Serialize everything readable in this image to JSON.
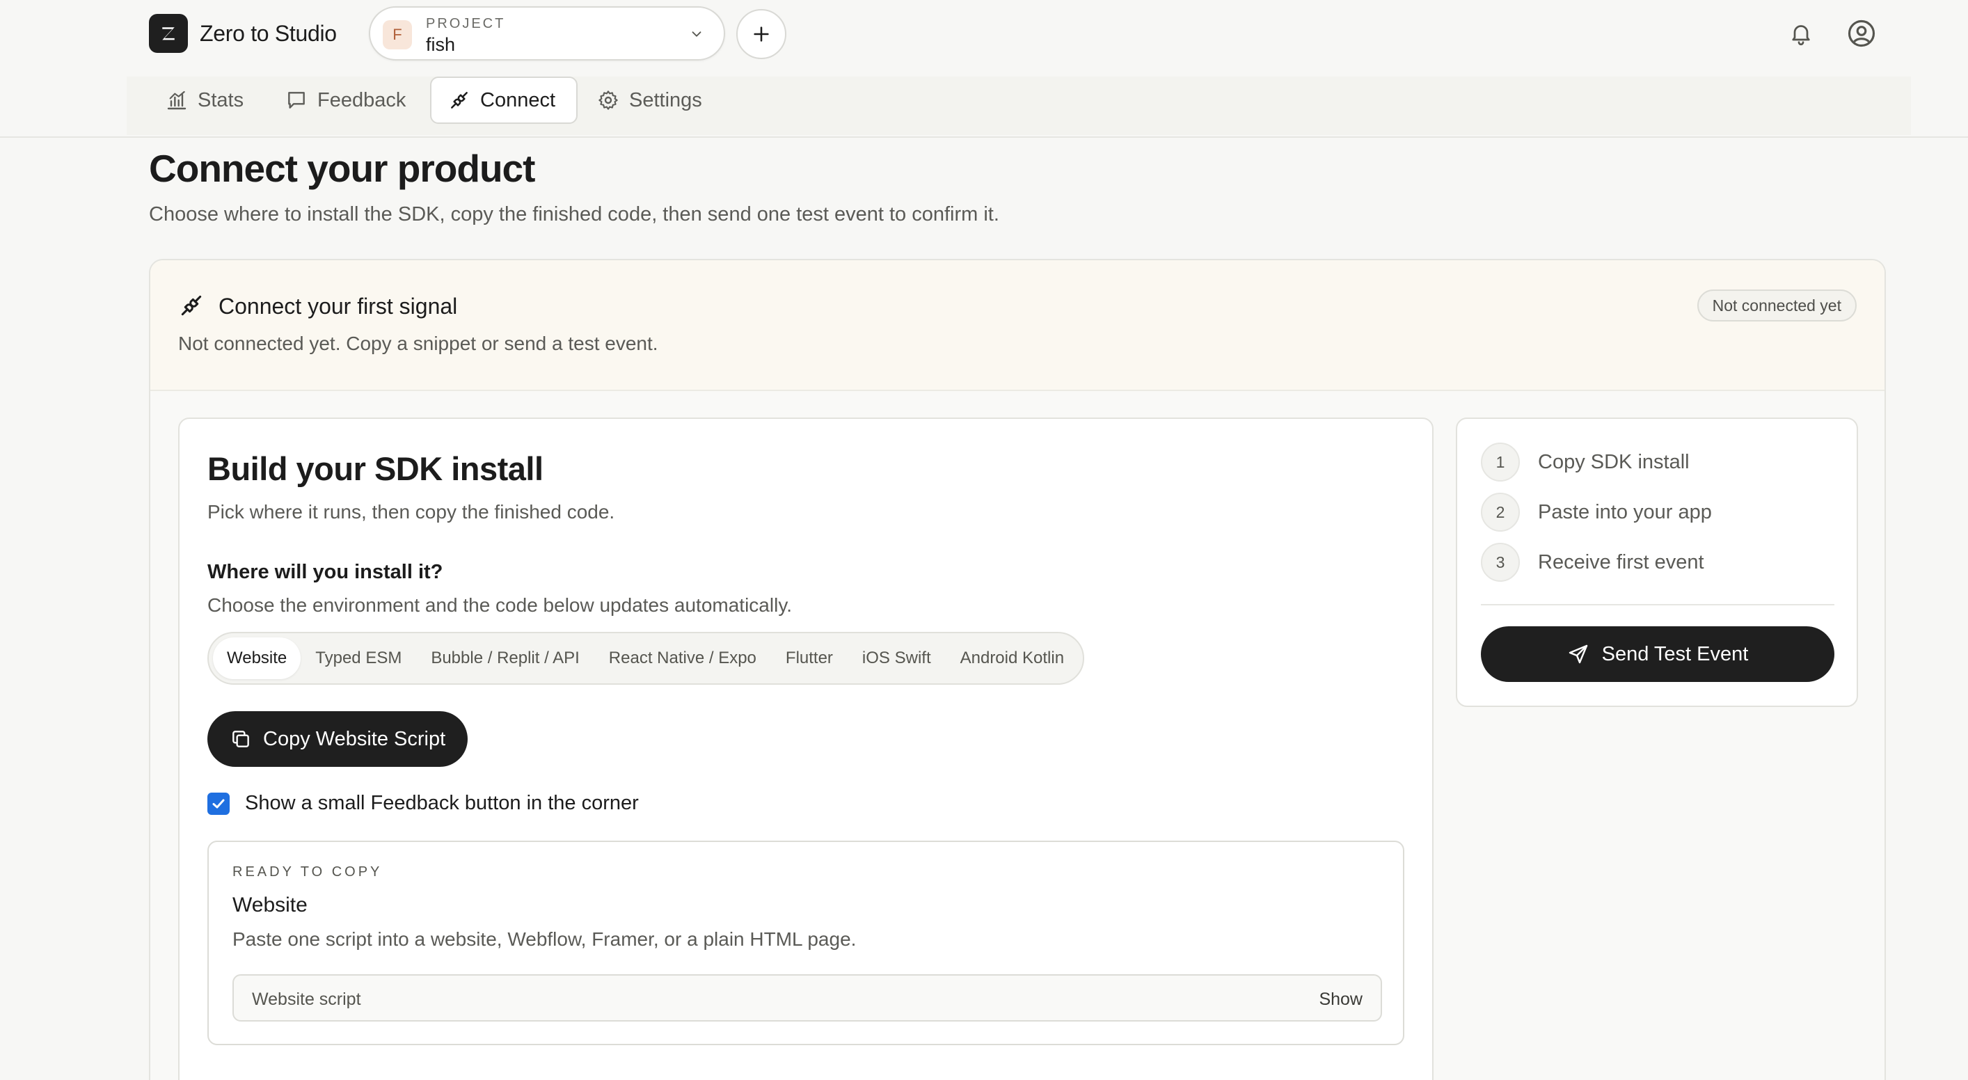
{
  "header": {
    "logo_letter": "Z",
    "app_name": "Zero to Studio",
    "project": {
      "kicker": "PROJECT",
      "avatar_letter": "F",
      "name": "fish"
    },
    "icons": [
      "logo-z-icon",
      "chevron-down-icon",
      "plus-icon",
      "bell-icon",
      "user-circle-icon"
    ]
  },
  "nav": {
    "tabs": [
      {
        "label": "Stats",
        "icon": "chart-icon",
        "active": false
      },
      {
        "label": "Feedback",
        "icon": "message-square-icon",
        "active": false
      },
      {
        "label": "Connect",
        "icon": "plug-icon",
        "active": true
      },
      {
        "label": "Settings",
        "icon": "gear-icon",
        "active": false
      }
    ]
  },
  "page": {
    "title": "Connect your product",
    "subtitle": "Choose where to install the SDK, copy the finished code, then send one test event to confirm it."
  },
  "signal": {
    "title": "Connect your first signal",
    "subtitle": "Not connected yet. Copy a snippet or send a test event.",
    "status_badge": "Not connected yet"
  },
  "build": {
    "title": "Build your SDK install",
    "subtitle": "Pick where it runs, then copy the finished code.",
    "env_question": "Where will you install it?",
    "env_help": "Choose the environment and the code below updates automatically.",
    "env_tabs": [
      {
        "label": "Website",
        "active": true
      },
      {
        "label": "Typed ESM",
        "active": false
      },
      {
        "label": "Bubble / Replit / API",
        "active": false
      },
      {
        "label": "React Native / Expo",
        "active": false
      },
      {
        "label": "Flutter",
        "active": false
      },
      {
        "label": "iOS Swift",
        "active": false
      },
      {
        "label": "Android Kotlin",
        "active": false
      }
    ],
    "copy_button": "Copy Website Script",
    "feedback_option": {
      "label": "Show a small Feedback button in the corner",
      "checked": true
    },
    "ready": {
      "kicker": "READY TO COPY",
      "title": "Website",
      "description": "Paste one script into a website, Webflow, Framer, or a plain HTML page.",
      "script_label": "Website script",
      "show_label": "Show"
    }
  },
  "steps": {
    "items": [
      {
        "number": "1",
        "label": "Copy SDK install"
      },
      {
        "number": "2",
        "label": "Paste into your app"
      },
      {
        "number": "3",
        "label": "Receive first event"
      }
    ],
    "send_button": "Send Test Event"
  },
  "colors": {
    "page_bg": "#f7f7f5",
    "dark_button": "#1f1f1f",
    "checkbox_blue": "#1f6fe0",
    "signal_header_bg": "#fbf8f1",
    "project_avatar_bg": "#f8e6da"
  }
}
